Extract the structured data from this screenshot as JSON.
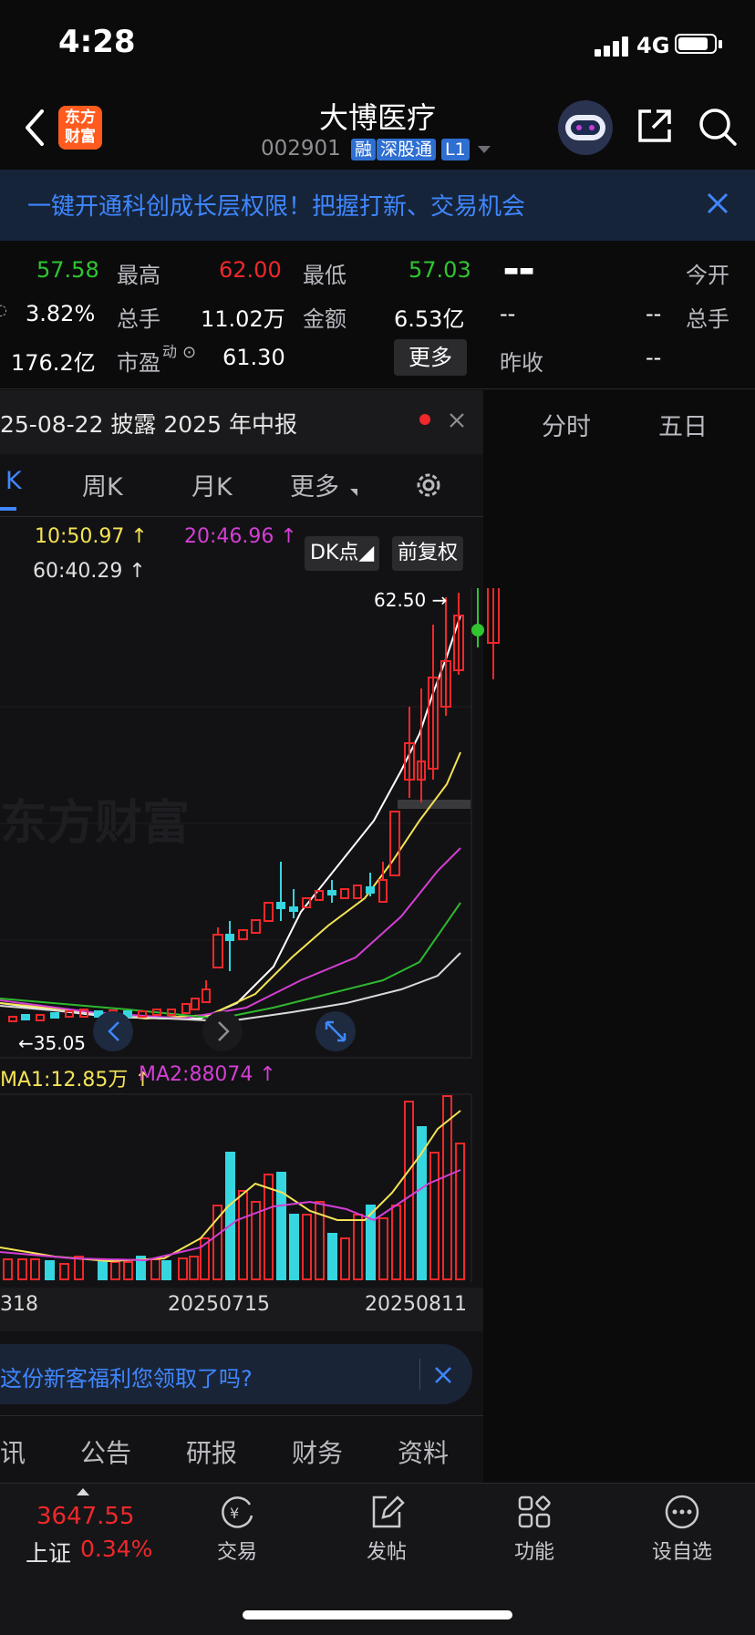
{
  "status": {
    "time": "4:28",
    "network": "4G"
  },
  "nav": {
    "title": "大博医疗",
    "code": "002901",
    "tags": [
      "融",
      "深股通",
      "L1"
    ],
    "logo_text": [
      "东方",
      "财富"
    ]
  },
  "banner": {
    "text": "一键开通科创成长层权限！把握打新、交易机会"
  },
  "quote": {
    "row1": {
      "price": "57.58",
      "high_label": "最高",
      "high": "62.00",
      "low_label": "最低",
      "low": "57.03",
      "dash": "▬▬",
      "open_label": "今开"
    },
    "row2": {
      "pct": "3.82%",
      "hand_label": "总手",
      "hand": "11.02万",
      "amount_label": "金额",
      "amount": "6.53亿",
      "dash1": "--",
      "dash2": "--",
      "hand2_label": "总手"
    },
    "row3": {
      "cap": "176.2亿",
      "pe_label": "市盈",
      "pe_sup": "动",
      "pe": "61.30",
      "more": "更多",
      "prev_label": "昨收",
      "prev": "--"
    }
  },
  "notice": {
    "text": "25-08-22 披露 2025 年中报"
  },
  "tabs": {
    "k": "K",
    "week": "周K",
    "month": "月K",
    "more": "更多",
    "fenshi": "分时",
    "wuri": "五日"
  },
  "ma": {
    "ma10": "10:50.97",
    "ma20": "20:46.96",
    "ma60": "60:40.29"
  },
  "chips": {
    "dk": "DK点",
    "fq": "前复权"
  },
  "chart_labels": {
    "high_mark": "62.50",
    "low_mark": "35.05",
    "watermark": "东方财富"
  },
  "volume": {
    "ma1": "MA1:12.85万",
    "ma2": "MA2:88074"
  },
  "dates": [
    "318",
    "20250715",
    "20250811"
  ],
  "promo": {
    "text": "这份新客福利您领取了吗?"
  },
  "info_tabs": [
    "讯",
    "公告",
    "研报",
    "财务",
    "资料"
  ],
  "bottom": {
    "index_value": "3647.55",
    "index_name": "上证",
    "index_pct": "0.34%",
    "items": [
      "交易",
      "发帖",
      "功能",
      "设自选"
    ]
  },
  "colors": {
    "up": "#f0282a",
    "down": "#2fc62f",
    "cyan": "#35d6e0",
    "accent": "#3f87ff"
  }
}
